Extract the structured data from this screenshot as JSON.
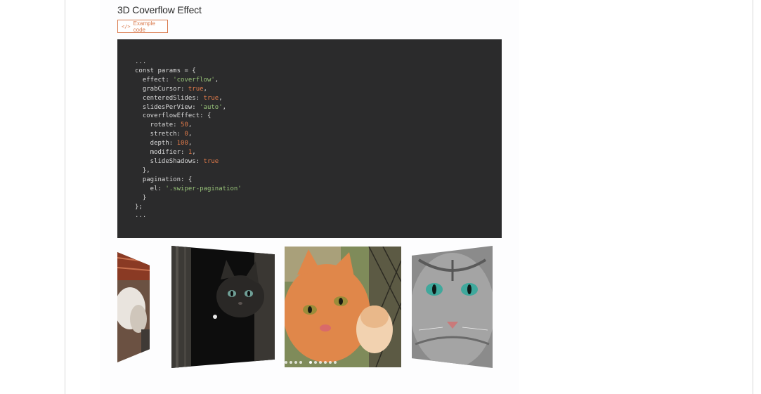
{
  "page": {
    "title": "3D Coverflow Effect",
    "example_button": {
      "icon": "code-icon",
      "label": "Example code"
    }
  },
  "code_lines": [
    [
      {
        "t": "..."
      }
    ],
    [
      {
        "t": "const params = {"
      }
    ],
    [
      {
        "t": "  effect: "
      },
      {
        "t": "'coverflow'",
        "c": "s"
      },
      {
        "t": ","
      }
    ],
    [
      {
        "t": "  grabCursor: "
      },
      {
        "t": "true",
        "c": "k"
      },
      {
        "t": ","
      }
    ],
    [
      {
        "t": "  centeredSlides: "
      },
      {
        "t": "true",
        "c": "k"
      },
      {
        "t": ","
      }
    ],
    [
      {
        "t": "  slidesPerView: "
      },
      {
        "t": "'auto'",
        "c": "s"
      },
      {
        "t": ","
      }
    ],
    [
      {
        "t": "  coverflowEffect: {"
      }
    ],
    [
      {
        "t": "    rotate: "
      },
      {
        "t": "50",
        "c": "k"
      },
      {
        "t": ","
      }
    ],
    [
      {
        "t": "    stretch: "
      },
      {
        "t": "0",
        "c": "k"
      },
      {
        "t": ","
      }
    ],
    [
      {
        "t": "    depth: "
      },
      {
        "t": "100",
        "c": "k"
      },
      {
        "t": ","
      }
    ],
    [
      {
        "t": "    modifier: "
      },
      {
        "t": "1",
        "c": "k"
      },
      {
        "t": ","
      }
    ],
    [
      {
        "t": "    slideShadows: "
      },
      {
        "t": "true",
        "c": "k"
      }
    ],
    [
      {
        "t": "  },"
      }
    ],
    [
      {
        "t": "  pagination: {"
      }
    ],
    [
      {
        "t": "    el: "
      },
      {
        "t": "'.swiper-pagination'",
        "c": "s"
      }
    ],
    [
      {
        "t": "  }"
      }
    ],
    [
      {
        "t": "};"
      }
    ],
    [
      {
        "t": "..."
      }
    ]
  ],
  "carousel": {
    "slides": [
      {
        "id": "slide-1",
        "subject": "white-cat-photo"
      },
      {
        "id": "slide-2",
        "subject": "black-kitten-photo"
      },
      {
        "id": "slide-3",
        "subject": "orange-cat-photo",
        "active": true
      },
      {
        "id": "slide-4",
        "subject": "grey-tabby-cat-photo"
      }
    ],
    "pagination": {
      "total": 10,
      "active_index": 4
    }
  },
  "colors": {
    "accent": "#d9784a",
    "code_bg": "#2b2b2c",
    "code_text": "#d9d9d9",
    "code_string": "#98c379",
    "code_keyword": "#e07a4a"
  }
}
